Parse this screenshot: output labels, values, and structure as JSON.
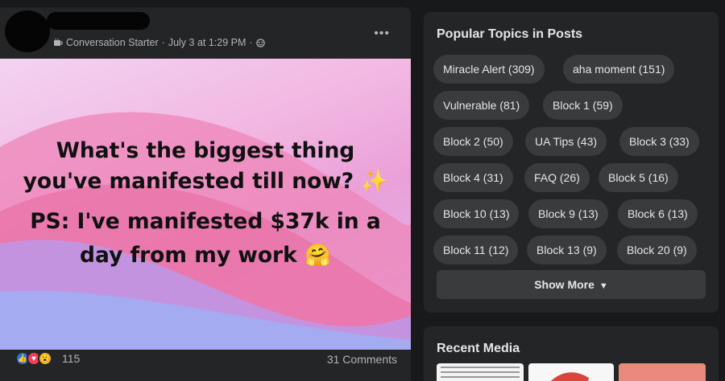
{
  "post": {
    "meta_group": "Conversation Starter",
    "meta_sep": "·",
    "meta_date": "July 3 at 1:29 PM",
    "more_label": "•••",
    "image_line1a": "What's the biggest thing",
    "image_line1b": "you've manifested till now?",
    "image_emoji1": "✨",
    "image_line2a": "PS: I've manifested $37k in a",
    "image_line2b": "day from my work",
    "image_emoji2": "🤗",
    "reaction_count": "115",
    "comments": "31 Comments"
  },
  "topics": {
    "title": "Popular Topics in Posts",
    "chips": [
      "Miracle Alert (309)",
      "aha moment (151)",
      "Vulnerable (81)",
      "Block 1 (59)",
      "Block 2 (50)",
      "UA Tips (43)",
      "Block 3 (33)",
      "Block 4 (31)",
      "FAQ (26)",
      "Block 5 (16)",
      "Block 10 (13)",
      "Block 9 (13)",
      "Block 6 (13)",
      "Block 11 (12)",
      "Block 13 (9)",
      "Block 20 (9)"
    ],
    "show_more": "Show More"
  },
  "media": {
    "title": "Recent Media"
  }
}
